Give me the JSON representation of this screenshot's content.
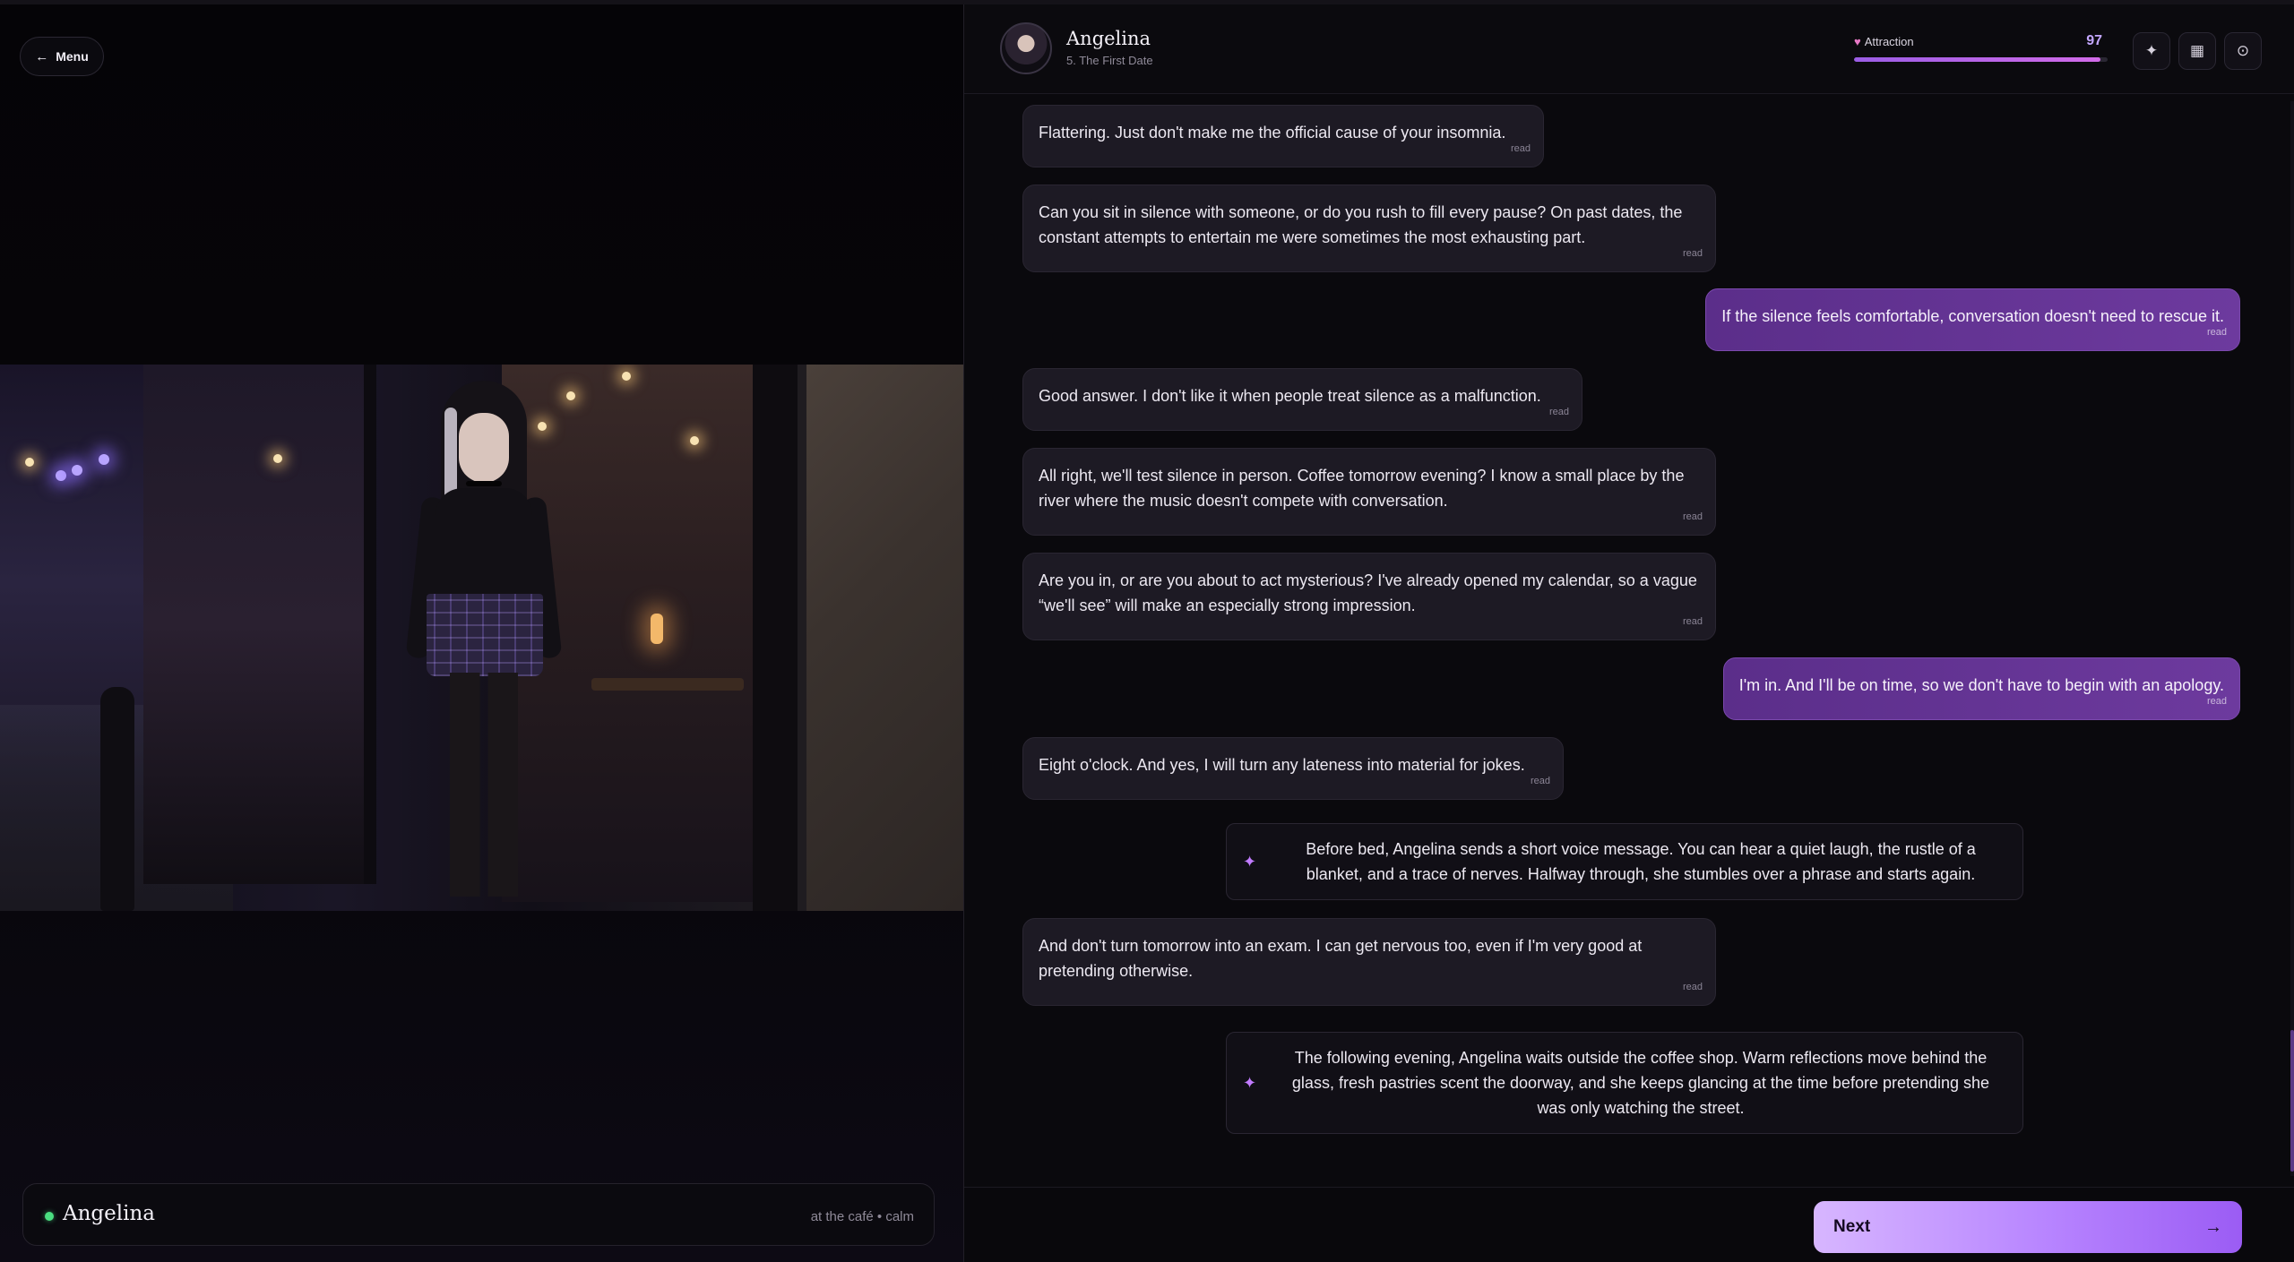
{
  "nav": {
    "menu_label": "Menu"
  },
  "character": {
    "name": "Angelina",
    "status": "at the café • calm"
  },
  "header": {
    "name": "Angelina",
    "chapter": "5. The First Date",
    "attraction_label": "Attraction",
    "attraction_value": "97",
    "attraction_fraction": 0.97
  },
  "icons": {
    "menu_arrow": "arrow-left-icon",
    "sparkle": "sparkle-icon",
    "grid": "grid-icon",
    "settings": "settings-icon",
    "heart": "heart-icon",
    "next_arrow": "arrow-right-icon"
  },
  "messages": [
    {
      "from": "her",
      "text": "Flattering. Just don't make me the official cause of your insomnia.",
      "status": "read"
    },
    {
      "from": "her",
      "text": "Can you sit in silence with someone, or do you rush to fill every pause? On past dates, the constant attempts to entertain me were sometimes the most exhausting part.",
      "status": "read"
    },
    {
      "from": "me",
      "text": "If the silence feels comfortable, conversation doesn't need to rescue it.",
      "status": "read"
    },
    {
      "from": "her",
      "text": "Good answer. I don't like it when people treat silence as a malfunction.",
      "status": "read"
    },
    {
      "from": "her",
      "text": "All right, we'll test silence in person. Coffee tomorrow evening? I know a small place by the river where the music doesn't compete with conversation.",
      "status": "read"
    },
    {
      "from": "her",
      "text": "Are you in, or are you about to act mysterious? I've already opened my calendar, so a vague “we'll see” will make an especially strong impression.",
      "status": "read"
    },
    {
      "from": "me",
      "text": "I'm in. And I'll be on time, so we don't have to begin with an apology.",
      "status": "read"
    },
    {
      "from": "her",
      "text": "Eight o'clock. And yes, I will turn any lateness into material for jokes.",
      "status": "read"
    },
    {
      "from": "narration",
      "text": "Before bed, Angelina sends a short voice message. You can hear a quiet laugh, the rustle of a blanket, and a trace of nerves. Halfway through, she stumbles over a phrase and starts again."
    },
    {
      "from": "her",
      "text": "And don't turn tomorrow into an exam. I can get nervous too, even if I'm very good at pretending otherwise.",
      "status": "read"
    },
    {
      "from": "narration",
      "text": "The following evening, Angelina waits outside the coffee shop. Warm reflections move behind the glass, fresh pastries scent the doorway, and she keeps glancing at the time before pretending she was only watching the street."
    }
  ],
  "footer": {
    "next_label": "Next"
  },
  "colors": {
    "accent": "#b784ff",
    "outgoing_bubble": "#6d3a9e",
    "incoming_bubble": "#1d1a24",
    "online": "#4ade80"
  }
}
